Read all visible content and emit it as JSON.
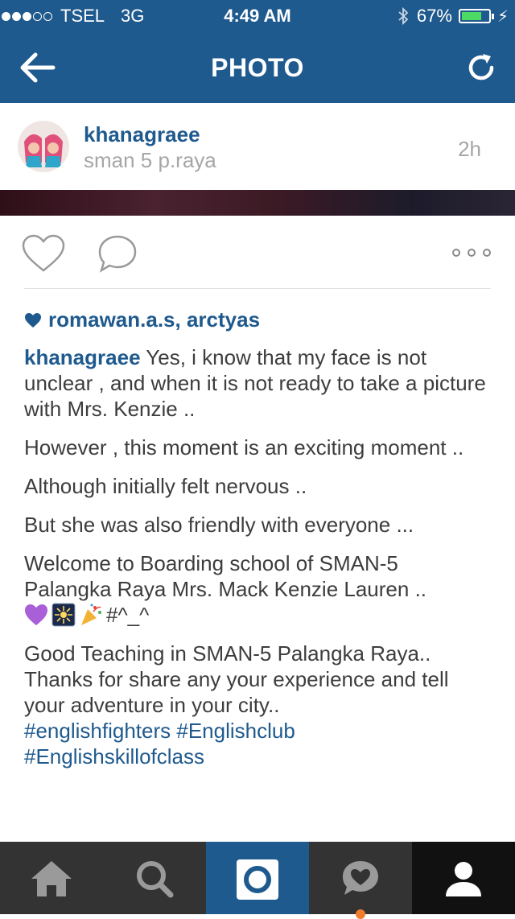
{
  "status_bar": {
    "carrier": "TSEL",
    "network": "3G",
    "time": "4:49 AM",
    "battery": "67%",
    "battery_level": 0.67,
    "signal_bars_filled": 3,
    "signal_bars_total": 5
  },
  "nav": {
    "title": "PHOTO",
    "back_icon": "back-arrow-icon",
    "refresh_icon": "refresh-icon"
  },
  "post": {
    "username": "khanagraee",
    "location": "sman 5 p.raya",
    "time_ago": "2h",
    "likes_text": "romawan.a.s, arctyas",
    "caption": {
      "author": "khanagraee",
      "first_line": " Yes, i know that my face is not unclear , and when it is not ready to take a picture with Mrs. Kenzie ..",
      "p2": "However , this moment is an exciting moment ..",
      "p3": "Although initially felt nervous ..",
      "p4": "But she was also friendly with everyone ...",
      "p5": "Welcome to Boarding school of SMAN-5 Palangka Raya Mrs. Mack Kenzie Lauren ..",
      "p5_suffix": "#^_^",
      "p6": "Good Teaching in SMAN-5 Palangka Raya.. Thanks for share any your experience and tell your adventure in your city..",
      "tag1": "#englishfighters",
      "tag2": "#Englishclub",
      "tag3": "#Englishskillofclass"
    }
  },
  "colors": {
    "brand_blue": "#1f5a8e",
    "tab_bar": "#333333",
    "notification_orange": "#f07d2e"
  },
  "tabbar": {
    "tabs": [
      "home-icon",
      "search-icon",
      "camera-icon",
      "activity-icon",
      "profile-icon"
    ],
    "active": "camera-icon"
  }
}
